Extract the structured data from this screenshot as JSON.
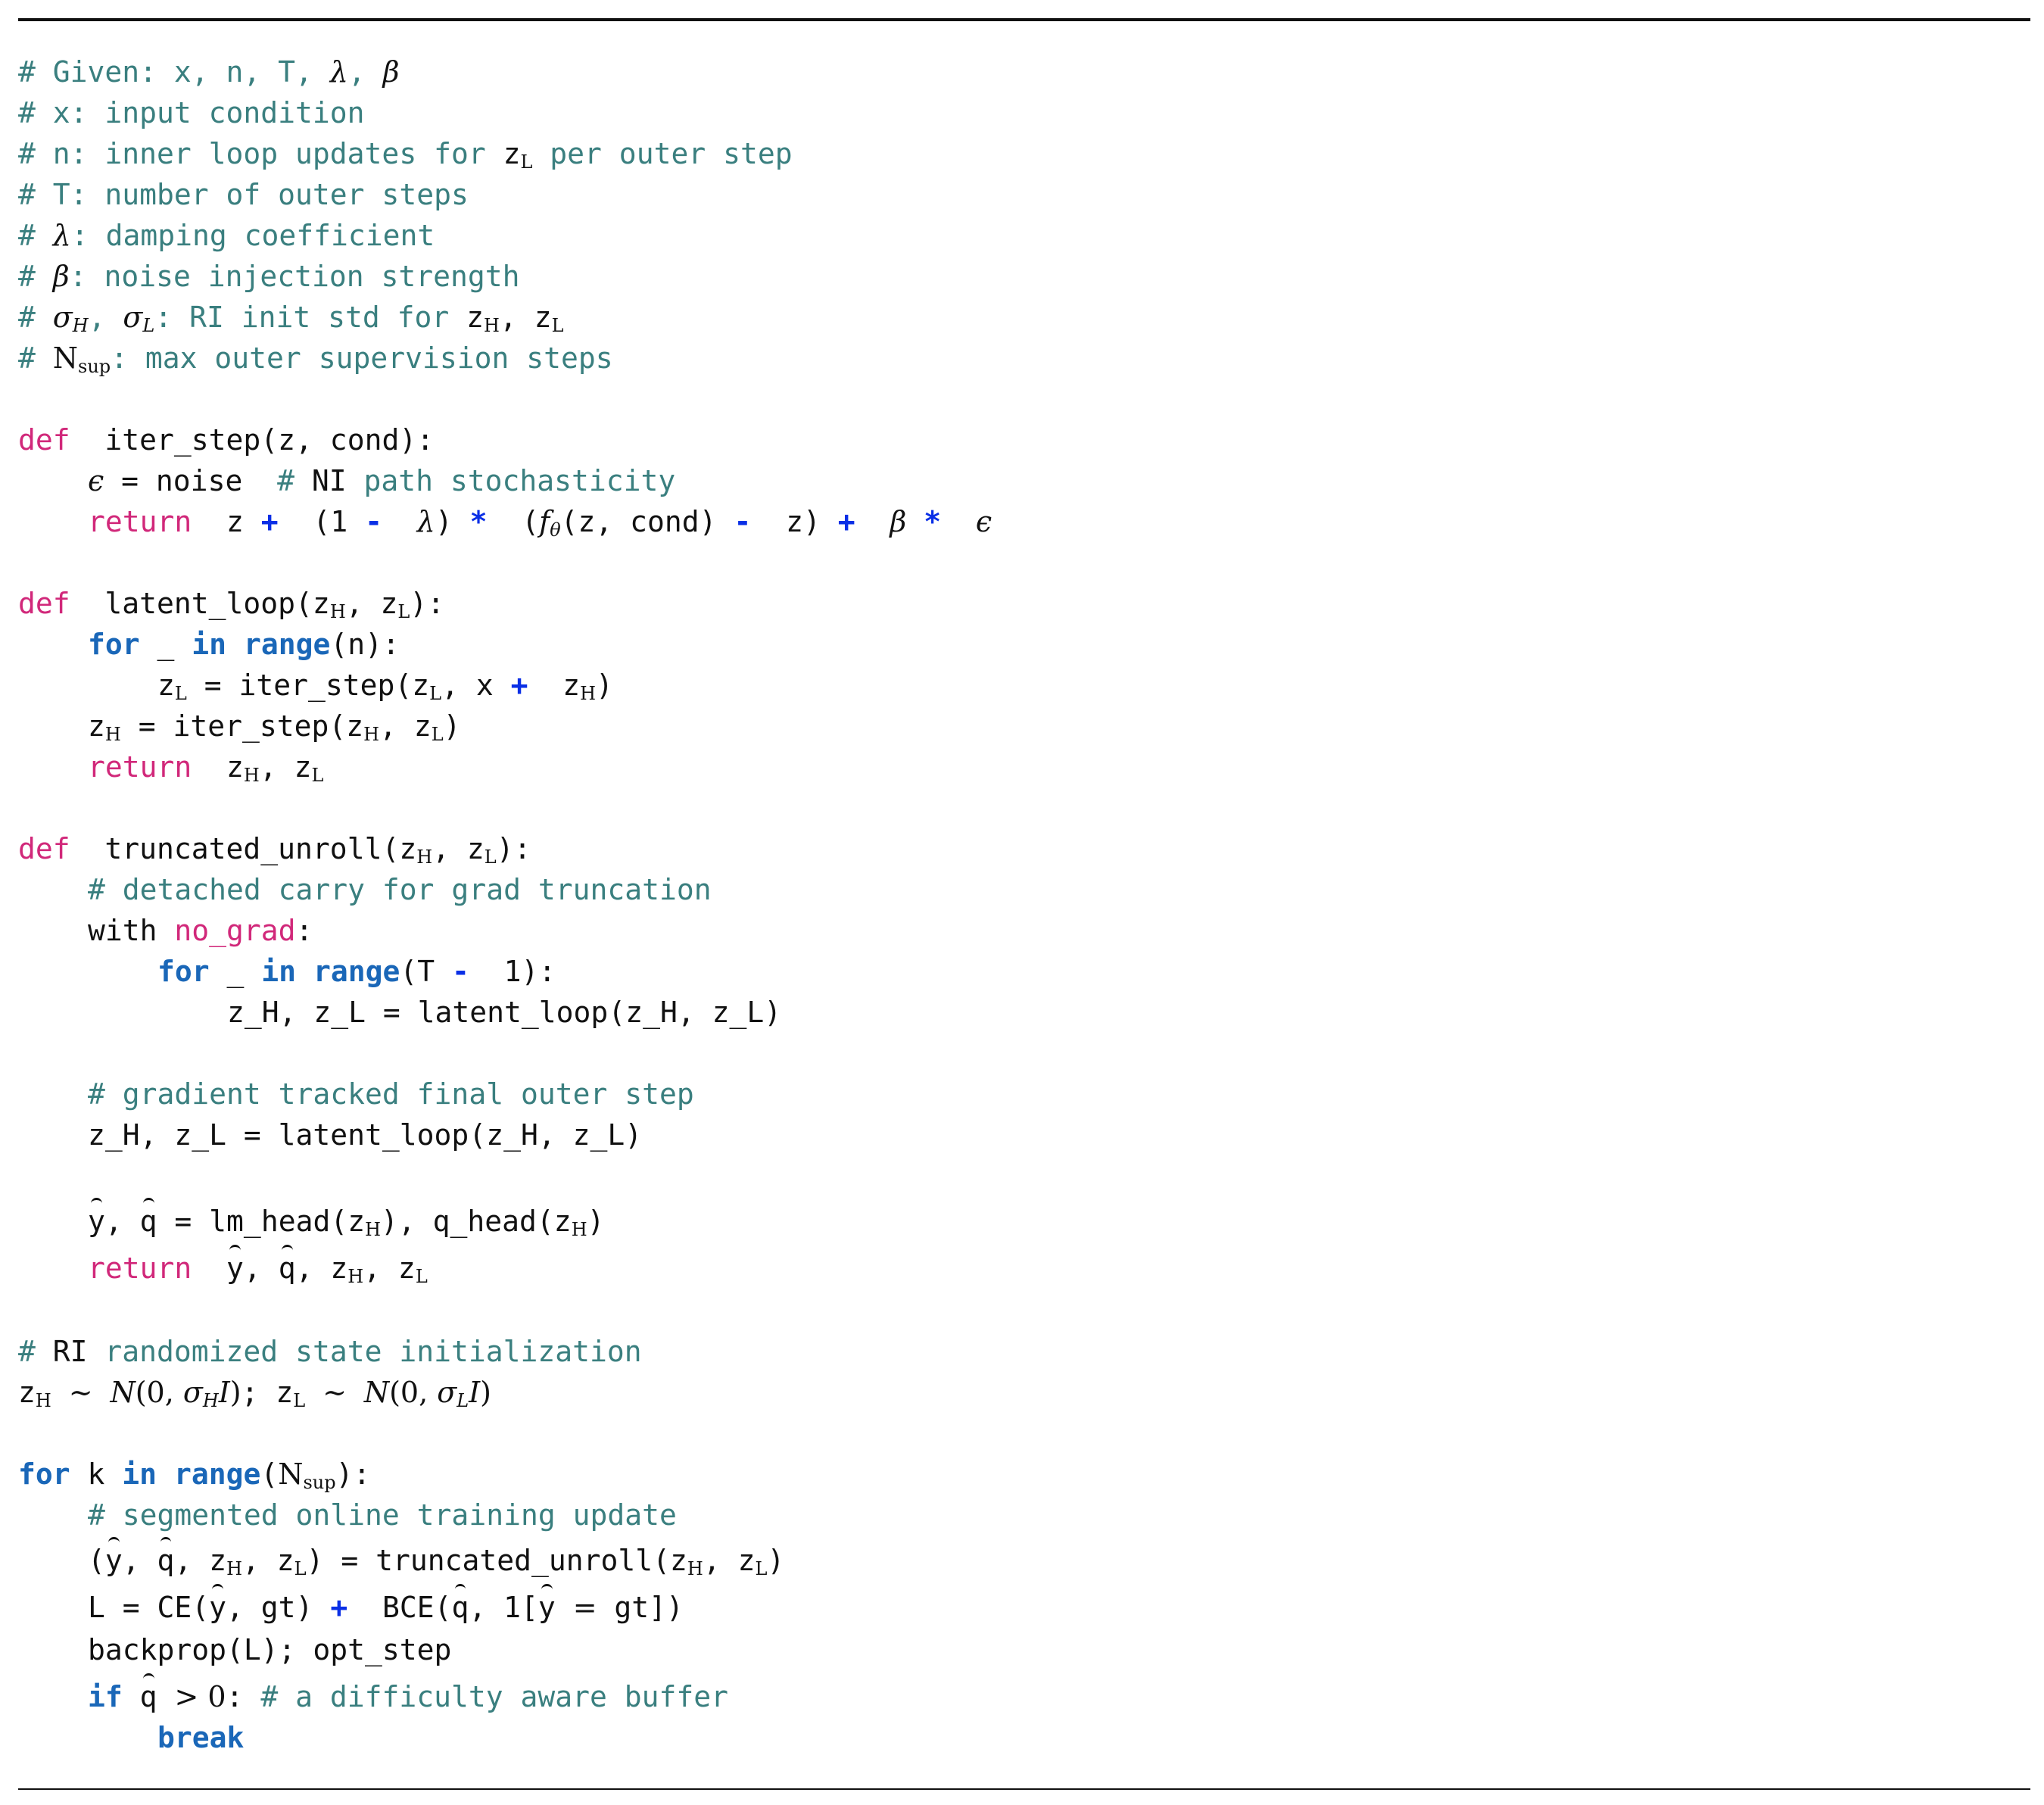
{
  "lines": [
    "# Given: x, n, T, λ, β",
    "# x: input condition",
    "# n: inner loop updates for z_L per outer step",
    "# T: number of outer steps",
    "# λ: damping coefficient",
    "# β: noise injection strength",
    "# σ_H, σ_L: RI init std for z_H, z_L",
    "# N_sup: max outer supervision steps",
    "def iter_step(z, cond):",
    "ϵ = noise # NI path stochasticity",
    "return z + (1 - λ) * (f_θ(z, cond) - z) + β * ϵ",
    "def latent_loop(z_H, z_L):",
    "for _ in range(n):",
    "z_L = iter_step(z_L, x + z_H)",
    "z_H = iter_step(z_H, z_L)",
    "return z_H, z_L",
    "def truncated_unroll(z_H, z_L):",
    "# detached carry for grad truncation",
    "with no_grad:",
    "for _ in range(T - 1):",
    "z_H, z_L = latent_loop(z_H, z_L)",
    "# gradient tracked final outer step",
    "z_H, z_L = latent_loop(z_H, z_L)",
    "ŷ, q̂ = lm_head(z_H), q_head(z_H)",
    "return ŷ, q̂, z_H, z_L",
    "# RI randomized state initialization",
    "z_H ∼ N(0, σ_H I); z_L ∼ N(0, σ_L I)",
    "for k in range(N_sup):",
    "# segmented online training update",
    "(ŷ, q̂, z_H, z_L) = truncated_unroll(z_H, z_L)",
    "L = CE(ŷ, gt) + BCE(q̂, 1[ŷ = gt])",
    "backprop(L); opt_step",
    "if q̂ > 0: # a difficulty aware buffer",
    "break"
  ]
}
